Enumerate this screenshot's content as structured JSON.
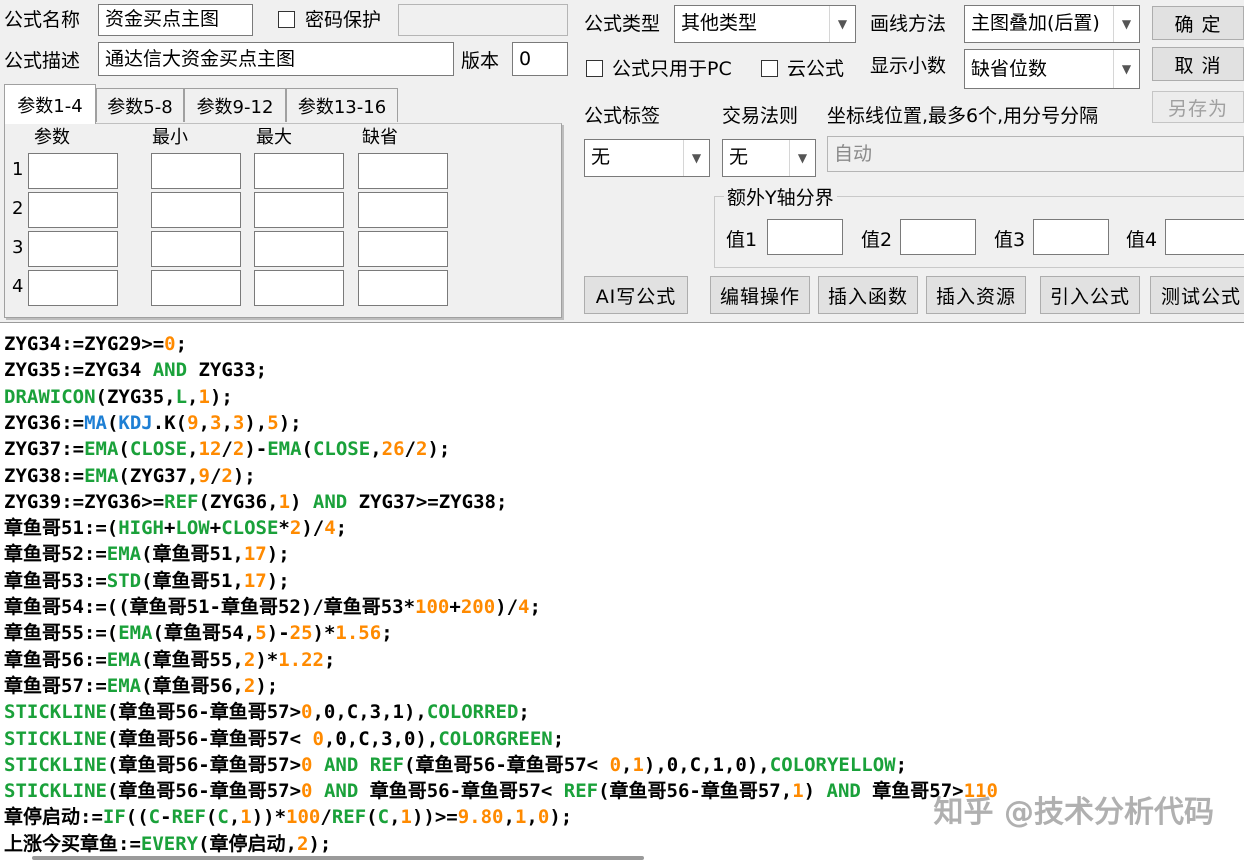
{
  "header": {
    "name_label": "公式名称",
    "name_value": "资金买点主图",
    "password_label": "密码保护",
    "password_checked": false,
    "password_value": "",
    "desc_label": "公式描述",
    "desc_value": "通达信大资金买点主图",
    "version_label": "版本",
    "version_value": "0",
    "type_label": "公式类型",
    "type_value": "其他类型",
    "draw_label": "画线方法",
    "draw_value": "主图叠加(后置)",
    "pc_only_label": "公式只用于PC",
    "pc_only_checked": false,
    "cloud_label": "云公式",
    "cloud_checked": false,
    "decimals_label": "显示小数",
    "decimals_value": "缺省位数"
  },
  "buttons": {
    "ok": "确  定",
    "cancel": "取  消",
    "save_as": "另存为"
  },
  "params": {
    "tabs": [
      "参数1-4",
      "参数5-8",
      "参数9-12",
      "参数13-16"
    ],
    "active_tab": 0,
    "columns": [
      "参数",
      "最小",
      "最大",
      "缺省"
    ],
    "rows": [
      "1",
      "2",
      "3",
      "4"
    ]
  },
  "tags": {
    "tag_label": "公式标签",
    "tag_value": "无",
    "trade_label": "交易法则",
    "trade_value": "无",
    "coord_label": "坐标线位置,最多6个,用分号分隔",
    "coord_value": "自动",
    "yaxis_group": "额外Y轴分界",
    "yaxis_values": [
      "值1",
      "值2",
      "值3",
      "值4"
    ]
  },
  "toolbar": {
    "ai_write": "AI写公式",
    "edit_ops": "编辑操作",
    "insert_func": "插入函数",
    "insert_res": "插入资源",
    "import_formula": "引入公式",
    "test_formula": "测试公式"
  },
  "code": {
    "lines": [
      [
        [
          "t",
          "ZYG34:=ZYG29>="
        ],
        [
          "n",
          "0"
        ],
        [
          "t",
          ";"
        ]
      ],
      [
        [
          "t",
          "ZYG35:=ZYG34 "
        ],
        [
          "k",
          "AND"
        ],
        [
          "t",
          " ZYG33;"
        ]
      ],
      [
        [
          "k",
          "DRAWICON"
        ],
        [
          "t",
          "(ZYG35,"
        ],
        [
          "k",
          "L"
        ],
        [
          "t",
          ","
        ],
        [
          "n",
          "1"
        ],
        [
          "t",
          ");"
        ]
      ],
      [
        [
          "t",
          "ZYG36:="
        ],
        [
          "b",
          "MA"
        ],
        [
          "t",
          "("
        ],
        [
          "b",
          "KDJ"
        ],
        [
          "t",
          ".K("
        ],
        [
          "n",
          "9"
        ],
        [
          "t",
          ","
        ],
        [
          "n",
          "3"
        ],
        [
          "t",
          ","
        ],
        [
          "n",
          "3"
        ],
        [
          "t",
          "),"
        ],
        [
          "n",
          "5"
        ],
        [
          "t",
          ");"
        ]
      ],
      [
        [
          "t",
          "ZYG37:="
        ],
        [
          "k",
          "EMA"
        ],
        [
          "t",
          "("
        ],
        [
          "k",
          "CLOSE"
        ],
        [
          "t",
          ","
        ],
        [
          "n",
          "12"
        ],
        [
          "t",
          "/"
        ],
        [
          "n",
          "2"
        ],
        [
          "t",
          ")-"
        ],
        [
          "k",
          "EMA"
        ],
        [
          "t",
          "("
        ],
        [
          "k",
          "CLOSE"
        ],
        [
          "t",
          ","
        ],
        [
          "n",
          "26"
        ],
        [
          "t",
          "/"
        ],
        [
          "n",
          "2"
        ],
        [
          "t",
          ");"
        ]
      ],
      [
        [
          "t",
          "ZYG38:="
        ],
        [
          "k",
          "EMA"
        ],
        [
          "t",
          "(ZYG37,"
        ],
        [
          "n",
          "9"
        ],
        [
          "t",
          "/"
        ],
        [
          "n",
          "2"
        ],
        [
          "t",
          ");"
        ]
      ],
      [
        [
          "t",
          "ZYG39:=ZYG36>="
        ],
        [
          "k",
          "REF"
        ],
        [
          "t",
          "(ZYG36,"
        ],
        [
          "n",
          "1"
        ],
        [
          "t",
          ") "
        ],
        [
          "k",
          "AND"
        ],
        [
          "t",
          " ZYG37>=ZYG38;"
        ]
      ],
      [
        [
          "t",
          "章鱼哥51:=("
        ],
        [
          "k",
          "HIGH"
        ],
        [
          "t",
          "+"
        ],
        [
          "k",
          "LOW"
        ],
        [
          "t",
          "+"
        ],
        [
          "k",
          "CLOSE"
        ],
        [
          "t",
          "*"
        ],
        [
          "n",
          "2"
        ],
        [
          "t",
          ")/"
        ],
        [
          "n",
          "4"
        ],
        [
          "t",
          ";"
        ]
      ],
      [
        [
          "t",
          "章鱼哥52:="
        ],
        [
          "k",
          "EMA"
        ],
        [
          "t",
          "(章鱼哥51,"
        ],
        [
          "n",
          "17"
        ],
        [
          "t",
          ");"
        ]
      ],
      [
        [
          "t",
          "章鱼哥53:="
        ],
        [
          "k",
          "STD"
        ],
        [
          "t",
          "(章鱼哥51,"
        ],
        [
          "n",
          "17"
        ],
        [
          "t",
          ");"
        ]
      ],
      [
        [
          "t",
          "章鱼哥54:=((章鱼哥51-章鱼哥52)/章鱼哥53*"
        ],
        [
          "n",
          "100"
        ],
        [
          "t",
          "+"
        ],
        [
          "n",
          "200"
        ],
        [
          "t",
          ")/"
        ],
        [
          "n",
          "4"
        ],
        [
          "t",
          ";"
        ]
      ],
      [
        [
          "t",
          "章鱼哥55:=("
        ],
        [
          "k",
          "EMA"
        ],
        [
          "t",
          "(章鱼哥54,"
        ],
        [
          "n",
          "5"
        ],
        [
          "t",
          ")-"
        ],
        [
          "n",
          "25"
        ],
        [
          "t",
          ")*"
        ],
        [
          "n",
          "1.56"
        ],
        [
          "t",
          ";"
        ]
      ],
      [
        [
          "t",
          "章鱼哥56:="
        ],
        [
          "k",
          "EMA"
        ],
        [
          "t",
          "(章鱼哥55,"
        ],
        [
          "n",
          "2"
        ],
        [
          "t",
          ")*"
        ],
        [
          "n",
          "1.22"
        ],
        [
          "t",
          ";"
        ]
      ],
      [
        [
          "t",
          "章鱼哥57:="
        ],
        [
          "k",
          "EMA"
        ],
        [
          "t",
          "(章鱼哥56,"
        ],
        [
          "n",
          "2"
        ],
        [
          "t",
          ");"
        ]
      ],
      [
        [
          "k",
          "STICKLINE"
        ],
        [
          "t",
          "(章鱼哥56-章鱼哥57>"
        ],
        [
          "n",
          "0"
        ],
        [
          "t",
          ",0,C,3,1),"
        ],
        [
          "k",
          "COLORRED"
        ],
        [
          "t",
          ";"
        ]
      ],
      [
        [
          "k",
          "STICKLINE"
        ],
        [
          "t",
          "(章鱼哥56-章鱼哥57< "
        ],
        [
          "n",
          "0"
        ],
        [
          "t",
          ",0,C,3,0),"
        ],
        [
          "k",
          "COLORGREEN"
        ],
        [
          "t",
          ";"
        ]
      ],
      [
        [
          "k",
          "STICKLINE"
        ],
        [
          "t",
          "(章鱼哥56-章鱼哥57>"
        ],
        [
          "n",
          "0"
        ],
        [
          "t",
          " "
        ],
        [
          "k",
          "AND"
        ],
        [
          "t",
          " "
        ],
        [
          "k",
          "REF"
        ],
        [
          "t",
          "(章鱼哥56-章鱼哥57< "
        ],
        [
          "n",
          "0"
        ],
        [
          "t",
          ","
        ],
        [
          "n",
          "1"
        ],
        [
          "t",
          "),0,C,1,0),"
        ],
        [
          "k",
          "COLORYELLOW"
        ],
        [
          "t",
          ";"
        ]
      ],
      [
        [
          "k",
          "STICKLINE"
        ],
        [
          "t",
          "(章鱼哥56-章鱼哥57>"
        ],
        [
          "n",
          "0"
        ],
        [
          "t",
          " "
        ],
        [
          "k",
          "AND"
        ],
        [
          "t",
          " 章鱼哥56-章鱼哥57< "
        ],
        [
          "k",
          "REF"
        ],
        [
          "t",
          "(章鱼哥56-章鱼哥57,"
        ],
        [
          "n",
          "1"
        ],
        [
          "t",
          ") "
        ],
        [
          "k",
          "AND"
        ],
        [
          "t",
          " 章鱼哥57>"
        ],
        [
          "n",
          "110"
        ]
      ],
      [
        [
          "t",
          "章停启动:="
        ],
        [
          "k",
          "IF"
        ],
        [
          "t",
          "(("
        ],
        [
          "k",
          "C"
        ],
        [
          "t",
          "-"
        ],
        [
          "k",
          "REF"
        ],
        [
          "t",
          "("
        ],
        [
          "k",
          "C"
        ],
        [
          "t",
          ","
        ],
        [
          "n",
          "1"
        ],
        [
          "t",
          "))*"
        ],
        [
          "n",
          "100"
        ],
        [
          "t",
          "/"
        ],
        [
          "k",
          "REF"
        ],
        [
          "t",
          "("
        ],
        [
          "k",
          "C"
        ],
        [
          "t",
          ","
        ],
        [
          "n",
          "1"
        ],
        [
          "t",
          "))>="
        ],
        [
          "n",
          "9.80"
        ],
        [
          "t",
          ","
        ],
        [
          "n",
          "1"
        ],
        [
          "t",
          ","
        ],
        [
          "n",
          "0"
        ],
        [
          "t",
          ");"
        ]
      ],
      [
        [
          "t",
          "上涨今买章鱼:="
        ],
        [
          "k",
          "EVERY"
        ],
        [
          "t",
          "(章停启动,"
        ],
        [
          "n",
          "2"
        ],
        [
          "t",
          ");"
        ]
      ]
    ]
  },
  "watermark": "知乎 @技术分析代码",
  "colors": {
    "keyword": "#1aa13a",
    "number": "#ff8a00",
    "function_blue": "#1e7fd4"
  }
}
